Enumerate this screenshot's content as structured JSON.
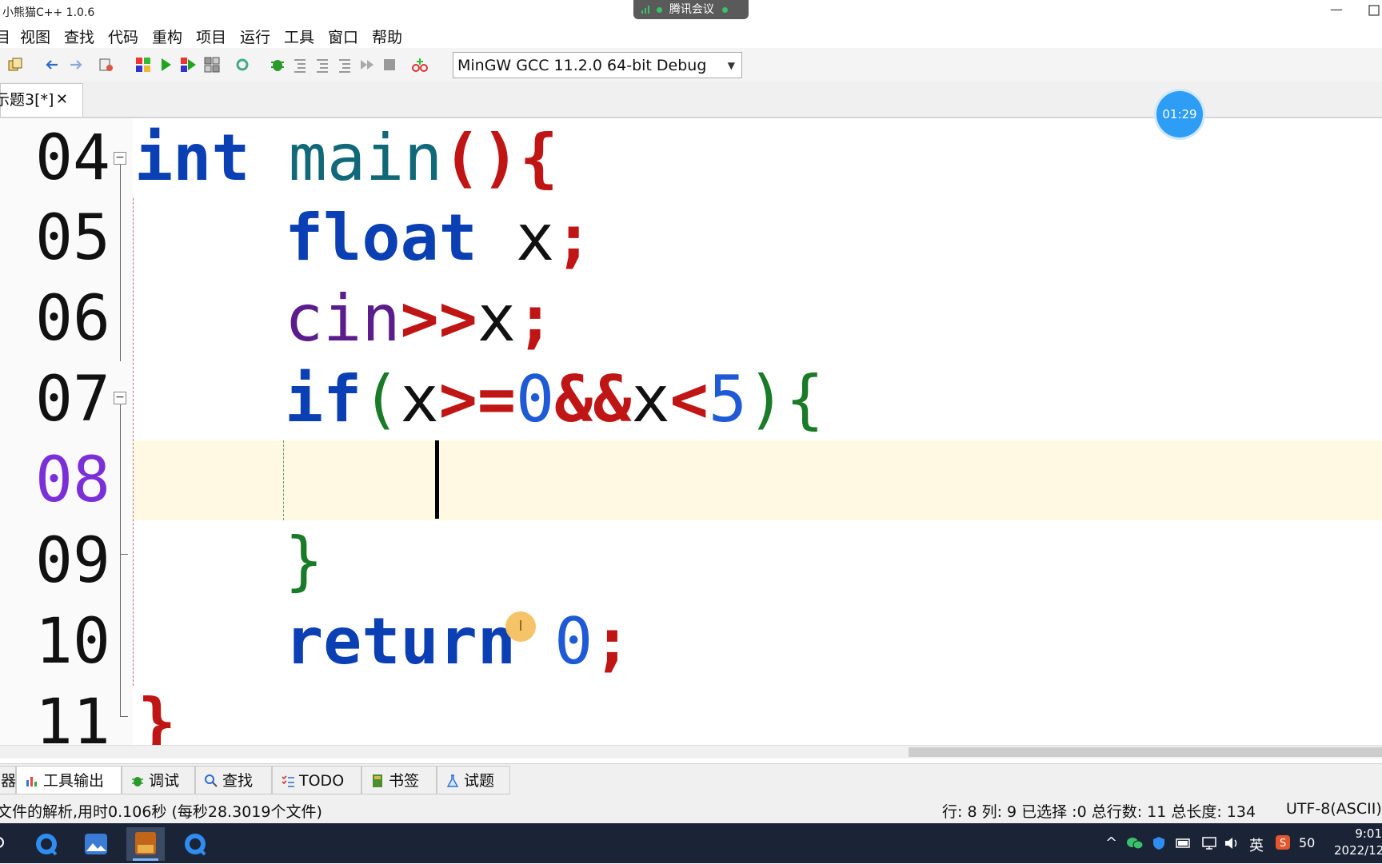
{
  "window": {
    "title": "小熊猫C++ 1.0.6",
    "minimize": "—"
  },
  "meeting_bar": {
    "label": "腾讯会议"
  },
  "menu": [
    "目",
    "视图",
    "查找",
    "代码",
    "重构",
    "项目",
    "运行",
    "工具",
    "窗口",
    "帮助"
  ],
  "compiler": {
    "selected": "MinGW GCC 11.2.0 64-bit Debug"
  },
  "editor_tab": {
    "label": "示题3[*]",
    "close": "✕"
  },
  "timer": "01:29",
  "line_numbers": [
    "04",
    "05",
    "06",
    "07",
    "08",
    "09",
    "10",
    "11"
  ],
  "code": {
    "l04": [
      "int",
      " ",
      "main",
      "()",
      "{"
    ],
    "l05": [
      "float",
      " x",
      ";"
    ],
    "l06": [
      "cin",
      ">>",
      "x",
      ";"
    ],
    "l07": [
      "if",
      "(",
      "x",
      ">=",
      "0",
      "&&",
      "x",
      "<",
      "5",
      ")",
      "{"
    ],
    "l09": [
      "}"
    ],
    "l10": [
      "return",
      " ",
      "0",
      ";"
    ],
    "l11": [
      "}"
    ]
  },
  "bottom_tabs": [
    "器",
    "工具输出",
    "调试",
    "查找",
    "TODO",
    "书签",
    "试题"
  ],
  "status": {
    "left": "文件的解析,用时0.106秒 (每秒28.3019个文件)",
    "position": "行: 8 列: 9 已选择 :0 总行数: 11 总长度: 134",
    "encoding": "UTF-8(ASCII)"
  },
  "taskbar": {
    "ime": "英",
    "battery": "50",
    "time": "9:01",
    "date": "2022/12"
  },
  "colors": {
    "keyword": "#0b3fb4",
    "function": "#106878",
    "operator": "#c01515",
    "number": "#1f5ad6",
    "bracket_green": "#197a27",
    "current_line": "#fff8e3",
    "active_line_number": "#7b2fd8"
  }
}
